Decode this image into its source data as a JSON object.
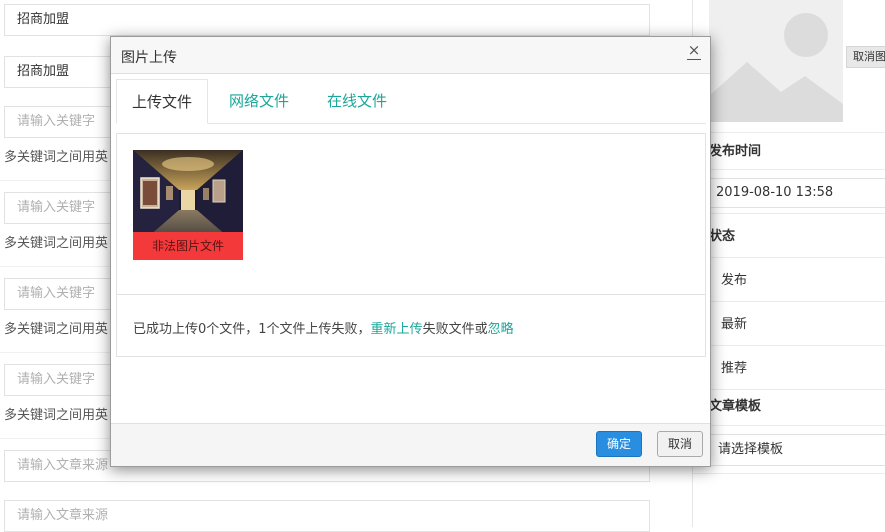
{
  "form": {
    "field1_value": "招商加盟",
    "field2_value": "招商加盟",
    "keyword_placeholder": "请输入关键字",
    "keyword_hint": "多关键词之间用英",
    "source_placeholder": "请输入文章来源"
  },
  "side": {
    "cancel_image_label": "取消图",
    "publish_time_label": "发布时间",
    "publish_time_value": "2019-08-10 13:58",
    "status_label": "状态",
    "status_options": [
      "发布",
      "最新",
      "推荐"
    ],
    "template_label": "文章模板",
    "template_placeholder": "请选择模板"
  },
  "dialog": {
    "title": "图片上传",
    "close_glyph": "×",
    "tabs": [
      "上传文件",
      "网络文件",
      "在线文件"
    ],
    "image_error_label": "非法图片文件",
    "status_prefix": "已成功上传0个文件，1个文件上传失败，",
    "status_retry": "重新上传",
    "status_middle": "失败文件或",
    "status_ignore": "忽略",
    "ok_label": "确定",
    "cancel_label": "取消"
  },
  "colors": {
    "accent_teal": "#1aa79a",
    "primary_button": "#2a8ee0",
    "error_red": "#f4393b"
  }
}
